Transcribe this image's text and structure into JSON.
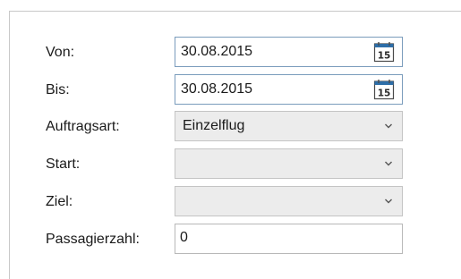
{
  "form": {
    "from": {
      "label": "Von:",
      "value": "30.08.2015",
      "calendar_day": "15"
    },
    "to": {
      "label": "Bis:",
      "value": "30.08.2015",
      "calendar_day": "15"
    },
    "order_type": {
      "label": "Auftragsart:",
      "value": "Einzelflug"
    },
    "start": {
      "label": "Start:",
      "value": ""
    },
    "destination": {
      "label": "Ziel:",
      "value": ""
    },
    "passengers": {
      "label": "Passagierzahl:",
      "value": "0"
    }
  },
  "colors": {
    "date_border": "#7a9cbc",
    "combo_background": "#ececec",
    "calendar_header": "#2d6ea8"
  },
  "icons": {
    "calendar": "calendar-icon",
    "dropdown": "chevron-down-icon"
  }
}
